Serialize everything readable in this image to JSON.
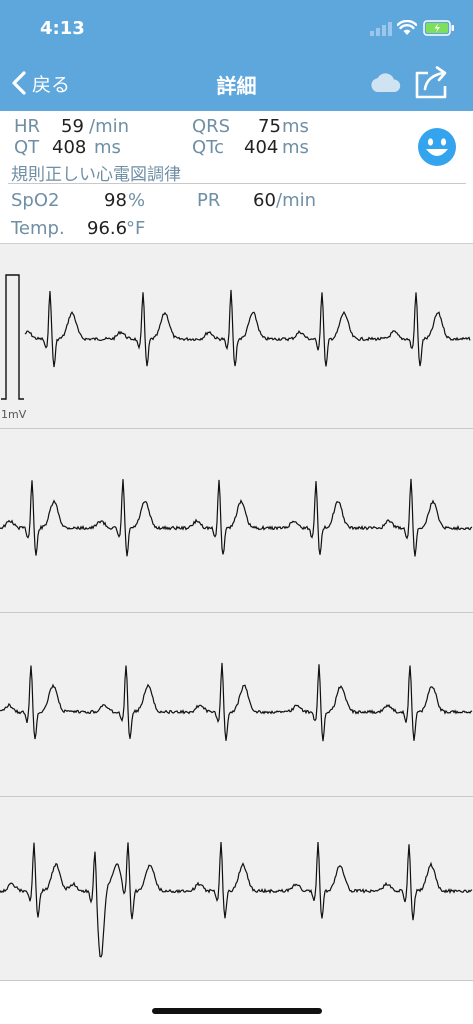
{
  "status_bar": {
    "time": "4:13"
  },
  "nav": {
    "back_label": "戻る",
    "title": "詳細"
  },
  "vitals": {
    "hr": {
      "label": "HR",
      "value": "59",
      "unit": "/min"
    },
    "qrs": {
      "label": "QRS",
      "value": "75",
      "unit": "ms"
    },
    "qt": {
      "label": "QT",
      "value": "408",
      "unit": "ms"
    },
    "qtc": {
      "label": "QTc",
      "value": "404",
      "unit": "ms"
    },
    "rhythm": "規則正しい心電図調律",
    "spo2": {
      "label": "SpO2",
      "value": "98",
      "unit": "%"
    },
    "pr": {
      "label": "PR",
      "value": "60",
      "unit": "/min"
    },
    "temp": {
      "label": "Temp.",
      "value": "96.6",
      "unit": "°F"
    }
  },
  "ecg": {
    "calibration_label": "1mV",
    "strip_count": 4
  },
  "colors": {
    "header": "#5ea7dd",
    "smiley": "#35a4ee",
    "label": "#6f8fa5",
    "trace": "#111111"
  },
  "icons": [
    "chevron-left-icon",
    "cloud-icon",
    "share-icon",
    "smiley-icon",
    "wifi-icon",
    "battery-icon",
    "signal-icon"
  ]
}
